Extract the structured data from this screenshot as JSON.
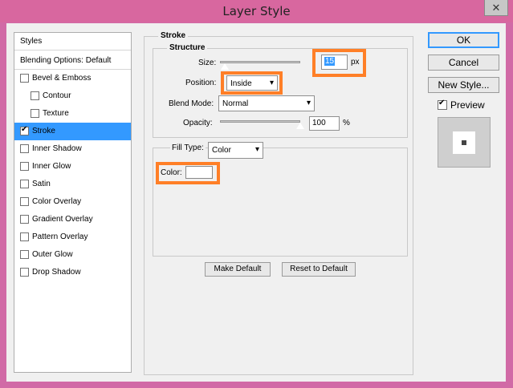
{
  "window": {
    "title": "Layer Style",
    "close_glyph": "✕"
  },
  "sidebar": {
    "header": "Styles",
    "blending": "Blending Options: Default",
    "items": [
      {
        "label": "Bevel & Emboss",
        "checked": false,
        "indent": false
      },
      {
        "label": "Contour",
        "checked": false,
        "indent": true
      },
      {
        "label": "Texture",
        "checked": false,
        "indent": true
      },
      {
        "label": "Stroke",
        "checked": true,
        "indent": false,
        "selected": true
      },
      {
        "label": "Inner Shadow",
        "checked": false,
        "indent": false
      },
      {
        "label": "Inner Glow",
        "checked": false,
        "indent": false
      },
      {
        "label": "Satin",
        "checked": false,
        "indent": false
      },
      {
        "label": "Color Overlay",
        "checked": false,
        "indent": false
      },
      {
        "label": "Gradient Overlay",
        "checked": false,
        "indent": false
      },
      {
        "label": "Pattern Overlay",
        "checked": false,
        "indent": false
      },
      {
        "label": "Outer Glow",
        "checked": false,
        "indent": false
      },
      {
        "label": "Drop Shadow",
        "checked": false,
        "indent": false
      }
    ]
  },
  "stroke": {
    "group_title": "Stroke",
    "structure_title": "Structure",
    "size_label": "Size:",
    "size_value": "15",
    "size_unit": "px",
    "size_slider_fraction": 0.06,
    "position_label": "Position:",
    "position_value": "Inside",
    "blend_label": "Blend Mode:",
    "blend_value": "Normal",
    "opacity_label": "Opacity:",
    "opacity_value": "100",
    "opacity_unit": "%",
    "opacity_slider_fraction": 1.0,
    "fill_type_label": "Fill Type:",
    "fill_type_value": "Color",
    "color_label": "Color:",
    "color_swatch": "#ffffff"
  },
  "actions": {
    "make_default": "Make Default",
    "reset_default": "Reset to Default",
    "ok": "OK",
    "cancel": "Cancel",
    "new_style": "New Style...",
    "preview_label": "Preview",
    "preview_checked": true
  },
  "colors": {
    "highlight": "#ff7f27",
    "selection": "#3399ff",
    "titlebar": "#d8679f"
  }
}
